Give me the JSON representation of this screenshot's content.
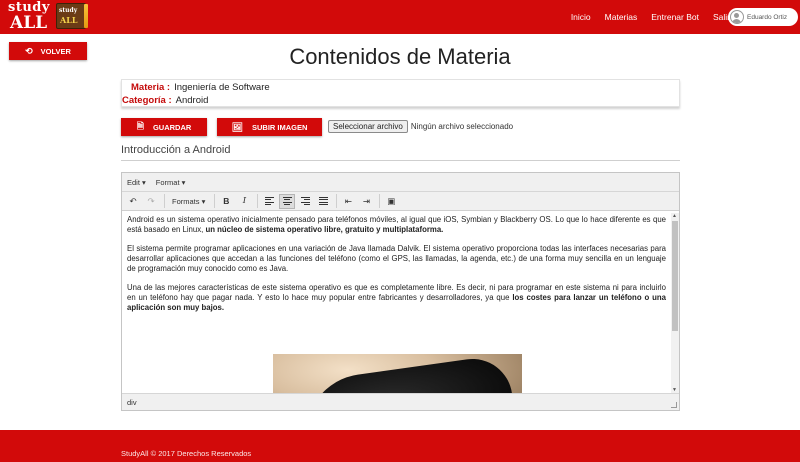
{
  "brand": {
    "logo_study": "study",
    "logo_all": "ALL",
    "logo_mini_study": "study",
    "logo_mini_all": "ALL"
  },
  "nav": {
    "links": [
      "Inicio",
      "Materias",
      "Entrenar Bot",
      "Salir"
    ],
    "user_name": "Eduardo Ortiz"
  },
  "back_button": {
    "label": "VOLVER",
    "icon": "undo-arrow-icon"
  },
  "page_title": "Contenidos de Materia",
  "info": {
    "materia_label": "Materia :",
    "materia_value": "Ingeniería de Software",
    "categoria_label": "Categoría :",
    "categoria_value": "Android"
  },
  "actions": {
    "save_label": "GUARDAR",
    "upload_label": "SUBIR IMAGEN",
    "file_button": "Seleccionar archivo",
    "file_status": "Ningún archivo seleccionado"
  },
  "section_title": "Introducción a Android",
  "editor": {
    "menu": [
      "Edit",
      "Format"
    ],
    "formats_label": "Formats",
    "toolbar_icons": [
      "undo-icon",
      "redo-icon",
      "bold-icon",
      "italic-icon",
      "align-left-icon",
      "align-center-icon",
      "align-right-icon",
      "align-justify-icon",
      "outdent-icon",
      "indent-icon",
      "image-icon"
    ],
    "paragraphs": [
      {
        "text": "Android es un sistema operativo inicialmente pensado para teléfonos móviles, al igual que iOS, Symbian y Blackberry OS. Lo que lo hace diferente es que está basado en Linux, ",
        "bold": "un núcleo de sistema operativo libre, gratuito y multiplataforma."
      },
      {
        "text": "El sistema permite programar aplicaciones en una variación de Java llamada Dalvik. El sistema operativo proporciona todas las interfaces necesarias para desarrollar aplicaciones que accedan a las funciones del teléfono (como el GPS, las llamadas, la agenda, etc.) de una forma muy sencilla en un lenguaje de programación muy conocido como es Java.",
        "bold": ""
      },
      {
        "text": "Una de las mejores características de este sistema operativo es que es completamente libre. Es decir, ni para programar en este sistema ni para incluirlo en un teléfono hay que pagar nada. Y esto lo hace muy popular entre fabricantes y desarrolladores, ya que ",
        "bold": "los costes para lanzar un teléfono o una aplicación son muy bajos."
      }
    ],
    "status_path": "div"
  },
  "footer": {
    "text": "StudyAll © 2017 Derechos Reservados"
  },
  "colors": {
    "primary": "#d20a0a",
    "label_red": "#c40a0a"
  }
}
